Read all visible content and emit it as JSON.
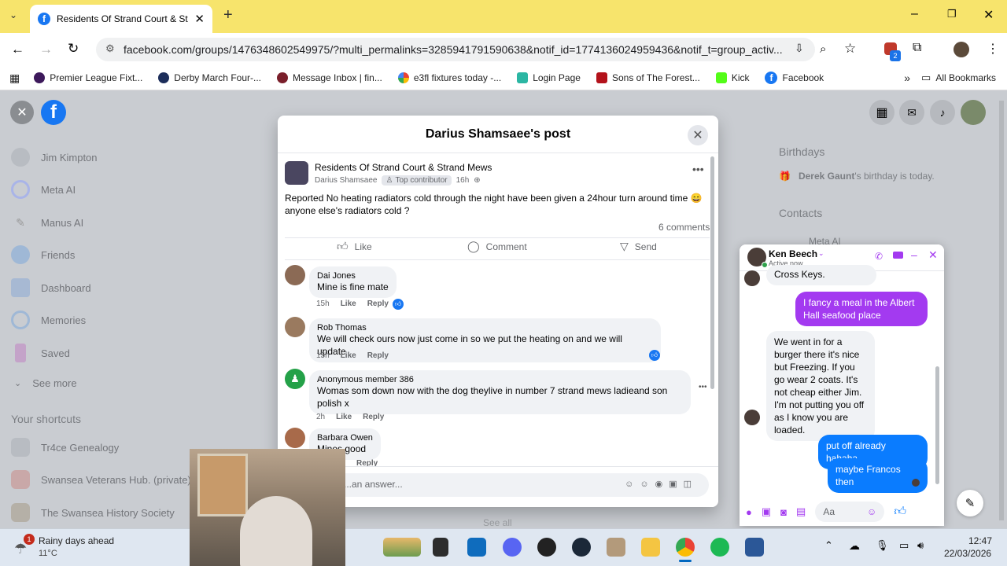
{
  "browser": {
    "tab_title": "Residents Of Strand Court & St",
    "url": "facebook.com/groups/1476348602549975/?multi_permalinks=3285941791590638&notif_id=1774136024959436&notif_t=group_activ...",
    "extension_badge": "2",
    "bookmarks": [
      "Premier League Fixt...",
      "Derby March Four-...",
      "Message Inbox | fin...",
      "e3fl fixtures today -...",
      "Login Page",
      "Sons of The Forest...",
      "Kick",
      "Facebook"
    ],
    "all_bookmarks": "All Bookmarks",
    "colors": {
      "tabstrip": "#f7e46c",
      "fb_blue": "#1877f2"
    }
  },
  "sidebar": {
    "items": [
      "Jim Kimpton",
      "Meta AI",
      "Manus AI",
      "Friends",
      "Dashboard",
      "Memories",
      "Saved"
    ],
    "see_more": "See more",
    "shortcuts_title": "Your shortcuts",
    "shortcuts": [
      "Tr4ce Genealogy",
      "Swansea Veterans Hub. (private)",
      "The Swansea History Society"
    ]
  },
  "right": {
    "birthdays_title": "Birthdays",
    "birthday_name": "Derek Gaunt",
    "birthday_text": "'s birthday is today.",
    "contacts_title": "Contacts",
    "contact_first": "Meta AI",
    "see_all": "See all"
  },
  "modal": {
    "title": "Darius Shamsaee's post",
    "group": "Residents Of Strand Court & Strand Mews",
    "author": "Darius Shamsaee",
    "badge": "Top contributor",
    "time": "16h",
    "post_text": "Reported No heating radiators cold through the night have been given a 24hour turn around time 😄 anyone else's radiators cold ?",
    "comments_count": "6 comments",
    "actions": {
      "like": "Like",
      "comment": "Comment",
      "send": "Send"
    },
    "comments": [
      {
        "name": "Dai Jones",
        "text": "Mine is fine mate",
        "time": "15h",
        "like": "Like",
        "reply": "Reply"
      },
      {
        "name": "Rob Thomas",
        "text": "We will check ours now just come in so we put the heating on and we will update",
        "time": "15h",
        "like": "Like",
        "reply": "Reply"
      },
      {
        "name": "Anonymous member 386",
        "text": "Womas som down now with the dog theylive in number 7 strand mews ladieand son polish x",
        "time": "2h",
        "like": "Like",
        "reply": "Reply"
      },
      {
        "name": "Barbara Owen",
        "text": "Mines good",
        "time": "",
        "like": "",
        "reply": "Reply"
      }
    ],
    "answer_placeholder": "...an answer..."
  },
  "chat": {
    "name": "Ken Beech",
    "status": "Active now",
    "messages": [
      {
        "from": "them",
        "text": "Cross Keys."
      },
      {
        "from": "me",
        "text": "I fancy a meal in the Albert Hall seafood place"
      },
      {
        "from": "them",
        "text": "We went in for a burger there it's nice but Freezing. If you go wear 2 coats. It's not cheap either Jim. I'm not putting you off as I know you are loaded."
      },
      {
        "from": "me",
        "text": "put off already hahaha"
      },
      {
        "from": "me",
        "text": "maybe Francos then"
      }
    ],
    "input_placeholder": "Aa",
    "colors": {
      "purple": "#a33af0",
      "blue": "#0a7cff"
    }
  },
  "taskbar": {
    "weather_title": "Rainy days ahead",
    "weather_temp": "11°C",
    "weather_badge": "1",
    "time": "12:47",
    "date": "22/03/2026"
  }
}
